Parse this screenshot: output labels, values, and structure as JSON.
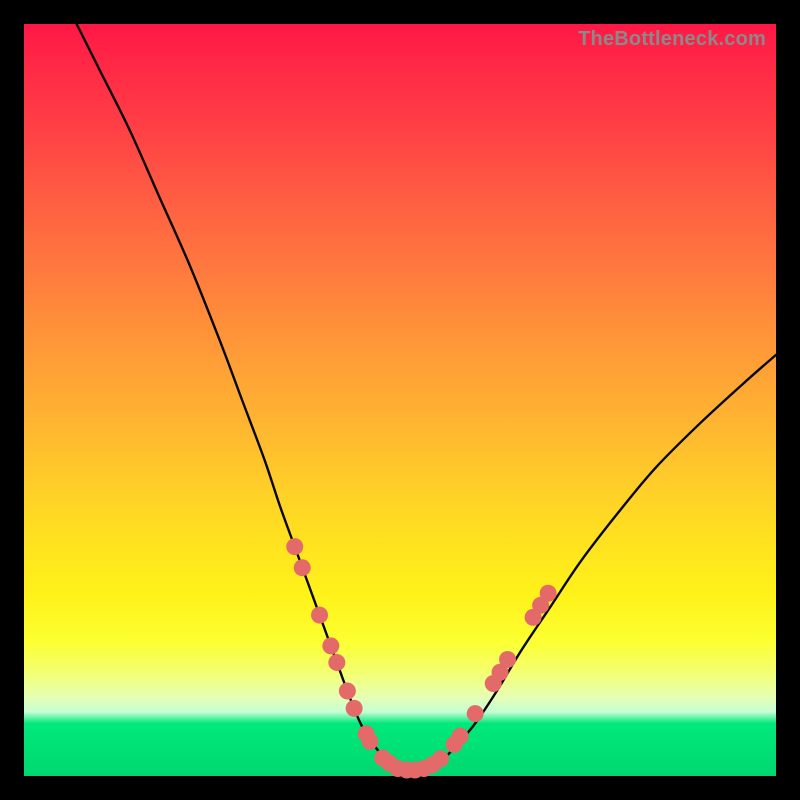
{
  "watermark": "TheBottleneck.com",
  "colors": {
    "curve_stroke": "#080808",
    "dot_fill": "#e46a6a",
    "background_black": "#000000"
  },
  "chart_data": {
    "type": "line",
    "title": "",
    "xlabel": "",
    "ylabel": "",
    "xlim": [
      0,
      100
    ],
    "ylim": [
      0,
      100
    ],
    "series": [
      {
        "name": "bottleneck-curve",
        "x": [
          7,
          10,
          14,
          18,
          22,
          26,
          29,
          32,
          34,
          36,
          38,
          40,
          42,
          43.5,
          45,
          47,
          49,
          51,
          53,
          55,
          57,
          60,
          63,
          66,
          70,
          74,
          79,
          84,
          90,
          96,
          100
        ],
        "y": [
          100,
          94,
          86,
          77,
          68,
          58,
          50,
          42,
          36,
          30.5,
          25,
          19.5,
          14,
          10,
          6.5,
          3.5,
          1.6,
          0.8,
          0.8,
          1.6,
          3.5,
          7,
          11.5,
          16.5,
          22.5,
          28.5,
          35,
          41,
          47,
          52.5,
          56
        ]
      }
    ],
    "markers": {
      "name": "highlight-dots",
      "points": [
        {
          "x": 36.0,
          "y": 30.5
        },
        {
          "x": 37.0,
          "y": 27.7
        },
        {
          "x": 39.3,
          "y": 21.4
        },
        {
          "x": 40.8,
          "y": 17.3
        },
        {
          "x": 41.6,
          "y": 15.1
        },
        {
          "x": 43.0,
          "y": 11.3
        },
        {
          "x": 43.9,
          "y": 9.0
        },
        {
          "x": 45.5,
          "y": 5.6
        },
        {
          "x": 46.0,
          "y": 4.6
        },
        {
          "x": 47.7,
          "y": 2.4
        },
        {
          "x": 48.6,
          "y": 1.7
        },
        {
          "x": 49.7,
          "y": 1.0
        },
        {
          "x": 50.9,
          "y": 0.8
        },
        {
          "x": 52.0,
          "y": 0.8
        },
        {
          "x": 53.2,
          "y": 1.0
        },
        {
          "x": 54.3,
          "y": 1.5
        },
        {
          "x": 55.4,
          "y": 2.3
        },
        {
          "x": 57.2,
          "y": 4.2
        },
        {
          "x": 58.0,
          "y": 5.3
        },
        {
          "x": 60.0,
          "y": 8.3
        },
        {
          "x": 62.4,
          "y": 12.3
        },
        {
          "x": 63.3,
          "y": 13.8
        },
        {
          "x": 64.3,
          "y": 15.5
        },
        {
          "x": 67.7,
          "y": 21.1
        },
        {
          "x": 68.7,
          "y": 22.7
        },
        {
          "x": 69.7,
          "y": 24.3
        }
      ]
    },
    "gradient_stops": [
      {
        "pct": 0,
        "color": "#ff1846"
      },
      {
        "pct": 50,
        "color": "#ffb830"
      },
      {
        "pct": 82,
        "color": "#fcff30"
      },
      {
        "pct": 93,
        "color": "#00e97b"
      },
      {
        "pct": 100,
        "color": "#00d86f"
      }
    ]
  }
}
